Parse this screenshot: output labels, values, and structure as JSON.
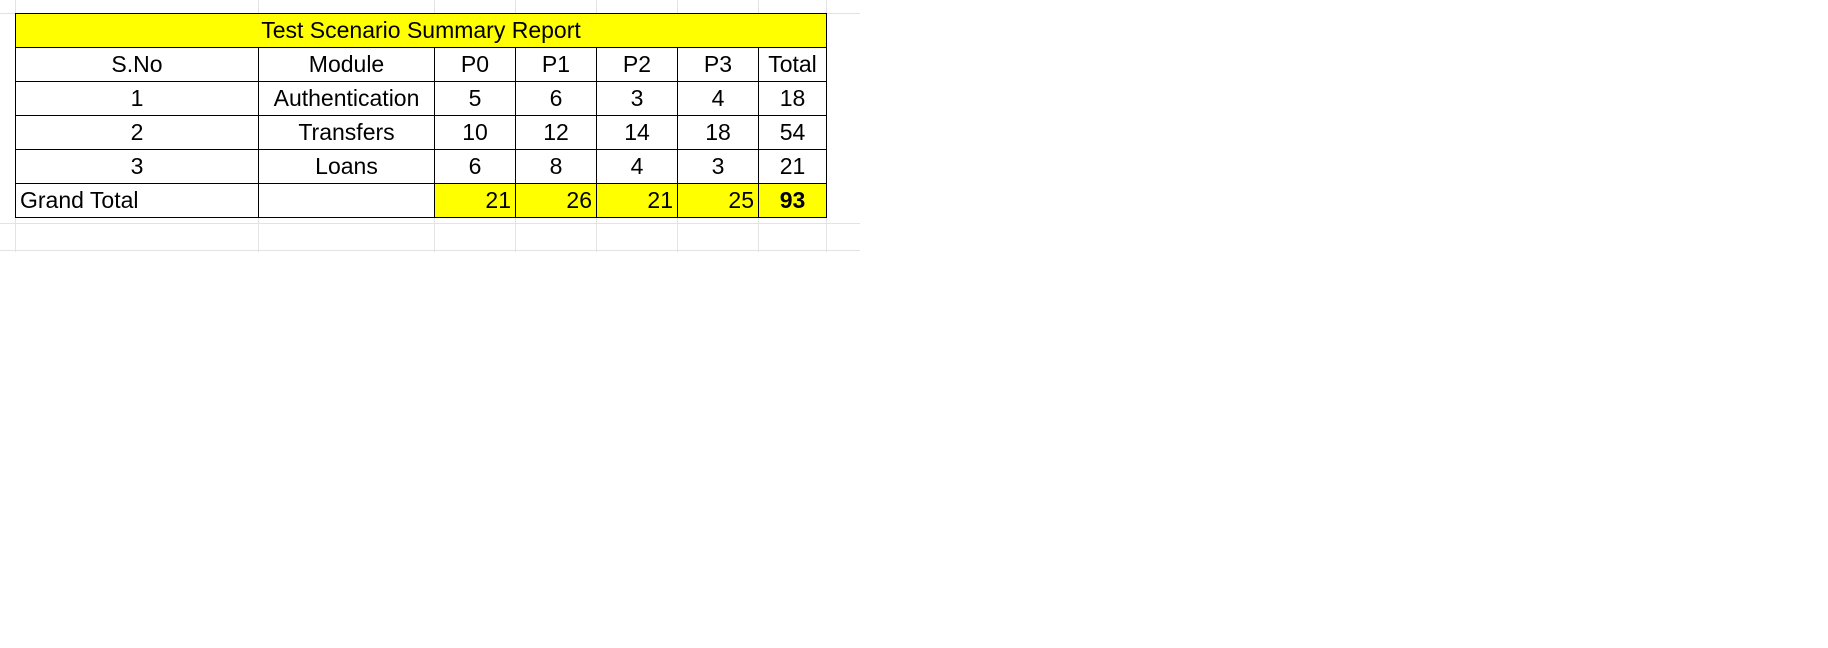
{
  "report": {
    "title": "Test Scenario Summary Report",
    "headers": [
      "S.No",
      "Module",
      "P0",
      "P1",
      "P2",
      "P3",
      "Total"
    ],
    "rows": [
      {
        "sno": "1",
        "module": "Authentication",
        "p0": "5",
        "p1": "6",
        "p2": "3",
        "p3": "4",
        "total": "18"
      },
      {
        "sno": "2",
        "module": "Transfers",
        "p0": "10",
        "p1": "12",
        "p2": "14",
        "p3": "18",
        "total": "54"
      },
      {
        "sno": "3",
        "module": "Loans",
        "p0": "6",
        "p1": "8",
        "p2": "4",
        "p3": "3",
        "total": "21"
      }
    ],
    "grand_total": {
      "label": "Grand Total",
      "module": "",
      "p0": "21",
      "p1": "26",
      "p2": "21",
      "p3": "25",
      "total": "93"
    },
    "highlight_color": "#ffff00"
  }
}
